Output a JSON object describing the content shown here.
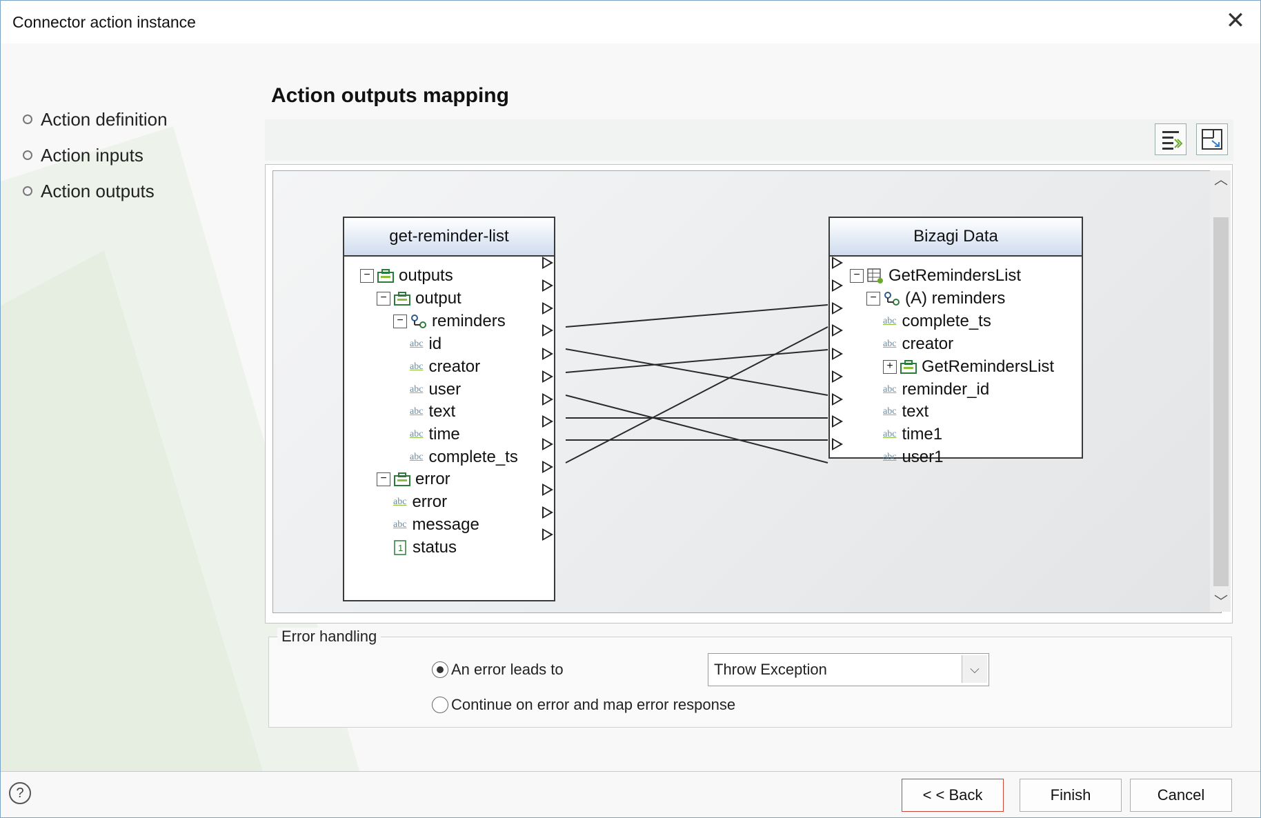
{
  "window": {
    "title": "Connector action instance",
    "close_icon": "close-icon"
  },
  "steps": [
    {
      "label": "Action definition"
    },
    {
      "label": "Action inputs"
    },
    {
      "label": "Action outputs"
    }
  ],
  "section_title": "Action outputs mapping",
  "toolbar": {
    "buttons": [
      "auto-map-icon",
      "expand-view-icon"
    ]
  },
  "source": {
    "title": "get-reminder-list",
    "rows": [
      "outputs",
      "output",
      "reminders",
      "id",
      "creator",
      "user",
      "text",
      "time",
      "complete_ts",
      "error",
      "error",
      "message",
      "status"
    ]
  },
  "target": {
    "title": "Bizagi Data",
    "rows": [
      "GetRemindersList",
      "(A) reminders",
      "complete_ts",
      "creator",
      "GetRemindersList",
      "reminder_id",
      "text",
      "time1",
      "user1"
    ]
  },
  "error_handling": {
    "legend": "Error handling",
    "option1": "An error leads to",
    "option2": "Continue on error and map error response",
    "selected_option": "An error leads to",
    "select_value": "Throw Exception"
  },
  "footer": {
    "back": "< < Back",
    "finish": "Finish",
    "cancel": "Cancel"
  }
}
